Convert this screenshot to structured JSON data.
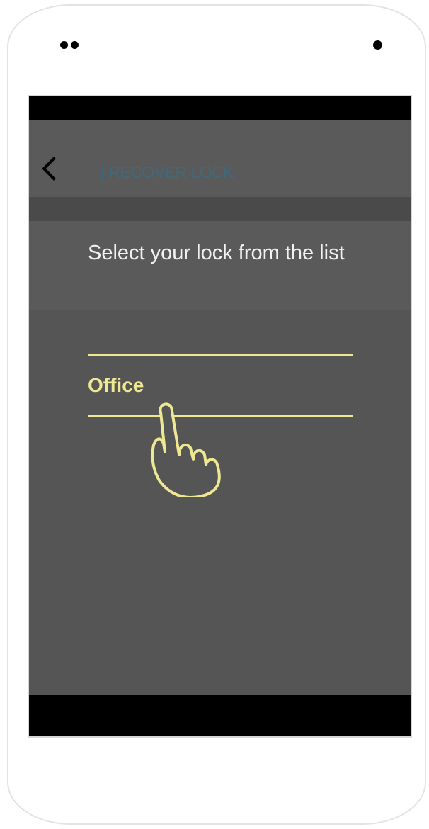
{
  "app_bar": {
    "title": "| RECOVER LOCK",
    "back_icon": "chevron-left-icon"
  },
  "prompt": {
    "text": "Select your lock from the list"
  },
  "lock_list": {
    "items": [
      {
        "label": "Office"
      }
    ]
  },
  "gesture": {
    "icon": "tap-hand-icon"
  },
  "colors": {
    "accent": "#eee892",
    "title": "#3f6a7c",
    "screen_bg": "#555555",
    "bar_bg": "#5a5a5a",
    "band_bg": "#4a4a4a"
  }
}
